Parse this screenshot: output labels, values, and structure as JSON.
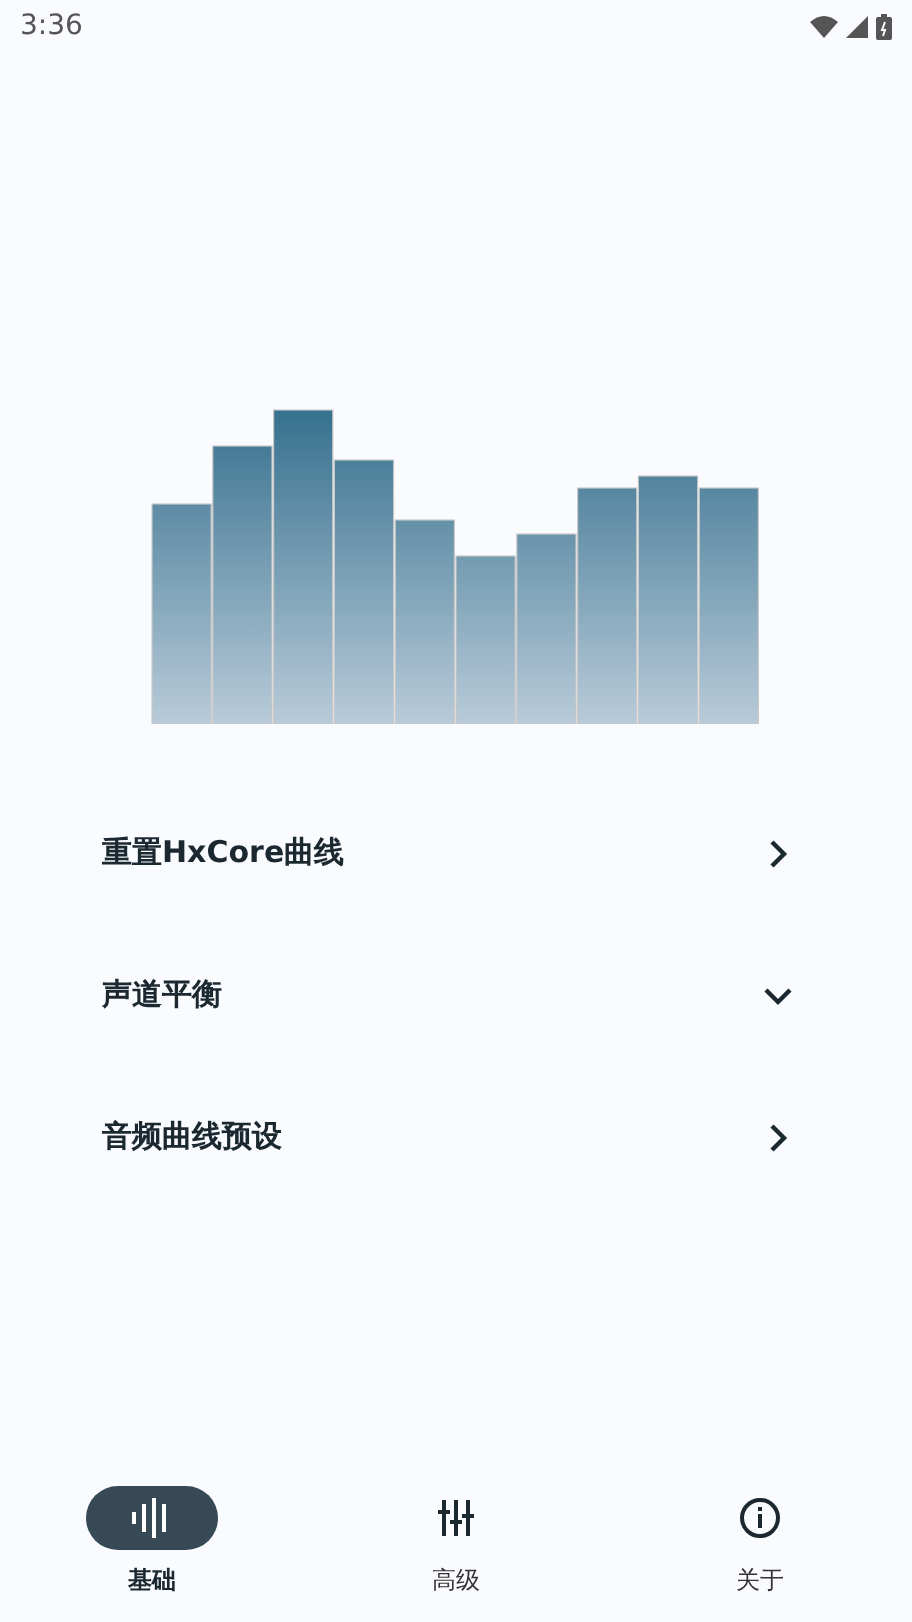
{
  "status_bar": {
    "time": "3:36"
  },
  "menu": [
    {
      "label": "重置HxCore曲线",
      "kind": "link"
    },
    {
      "label": "声道平衡",
      "kind": "dropdown"
    },
    {
      "label": "音频曲线预设",
      "kind": "link"
    }
  ],
  "tabs": [
    {
      "label": "基础",
      "kind": "wave",
      "selected": true
    },
    {
      "label": "高级",
      "kind": "sliders",
      "selected": false
    },
    {
      "label": "关于",
      "kind": "info",
      "selected": false
    }
  ]
}
